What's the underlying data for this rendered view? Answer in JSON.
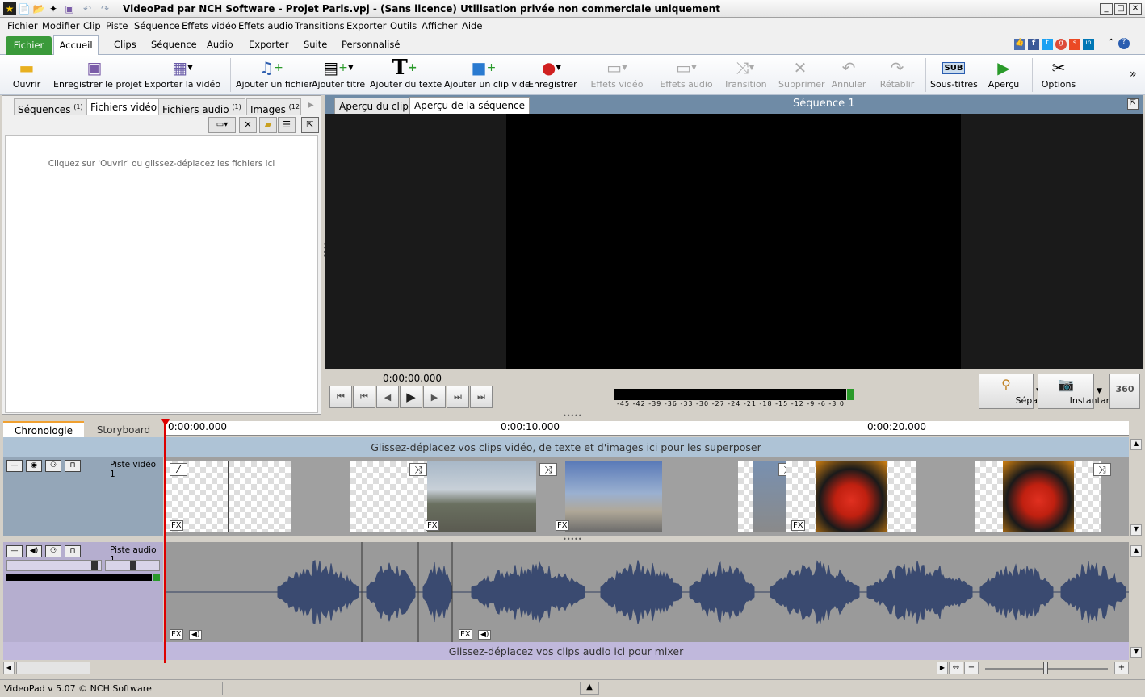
{
  "window": {
    "title": "VideoPad par NCH Software - Projet Paris.vpj - (Sans licence) Utilisation privée non commerciale uniquement"
  },
  "menu": [
    "Fichier",
    "Modifier",
    "Clip",
    "Piste",
    "Séquence",
    "Effets vidéo",
    "Effets audio",
    "Transitions",
    "Exporter",
    "Outils",
    "Afficher",
    "Aide"
  ],
  "ribbon_tabs": {
    "fichier": "Fichier",
    "accueil": "Accueil",
    "others": [
      "Clips",
      "Séquence",
      "Audio",
      "Exporter",
      "Suite",
      "Personnalisé"
    ]
  },
  "toolbar": {
    "ouvrir": "Ouvrir",
    "enregistrer": "Enregistrer le projet",
    "exporter": "Exporter la vidéo",
    "ajouter_fichier": "Ajouter un fichier",
    "ajouter_titre": "Ajouter titre",
    "ajouter_texte": "Ajouter du texte",
    "ajouter_clip_vide": "Ajouter un clip vide",
    "enregistrer_rec": "Enregistrer",
    "effets_video": "Effets vidéo",
    "effets_audio": "Effets audio",
    "transition": "Transition",
    "supprimer": "Supprimer",
    "annuler": "Annuler",
    "retablir": "Rétablir",
    "sous_titres": "Sous-titres",
    "apercu": "Aperçu",
    "options": "Options",
    "sub_badge": "SUB"
  },
  "bins": {
    "sequences": "Séquences",
    "sequences_count": "(1)",
    "fichiers_video": "Fichiers vidéo",
    "fichiers_audio": "Fichiers audio",
    "fichiers_audio_count": "(1)",
    "images": "Images",
    "images_count": "(12",
    "empty_hint": "Cliquez sur 'Ouvrir' ou glissez-déplacez les fichiers ici"
  },
  "preview": {
    "tab_clip": "Aperçu du clip",
    "tab_sequence": "Aperçu de la séquence",
    "sequence_title": "Séquence 1",
    "timecode": "0:00:00.000",
    "meter_scale": "-45 -42 -39 -36 -33 -30 -27 -24 -21 -18 -15 -12 -9 -6 -3 0",
    "separer": "Séparer",
    "instantane": "Instantané",
    "deg360": "360"
  },
  "timeline": {
    "tab_chrono": "Chronologie",
    "tab_storyboard": "Storyboard",
    "ruler": [
      "0:00:00.000",
      "0:00:10.000",
      "0:00:20.000"
    ],
    "overlay_hint": "Glissez-déplacez vos clips vidéo, de texte et d'images ici pour les superposer",
    "video_track": "Piste vidéo 1",
    "audio_track": "Piste audio 1",
    "mix_hint": "Glissez-déplacez vos clips audio ici pour mixer",
    "fx": "FX"
  },
  "status": {
    "text": "VideoPad v 5.07 © NCH Software"
  }
}
